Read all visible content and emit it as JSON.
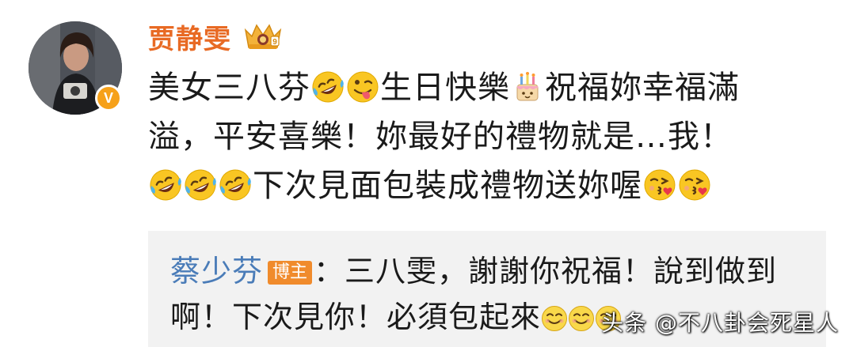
{
  "post": {
    "username": "贾静雯",
    "verified_badge": "V",
    "content": {
      "line1": {
        "t1": "美女三八芬",
        "t2": "生日快樂",
        "t3": "祝福妳幸福滿"
      },
      "line2": "溢，平安喜樂！妳最好的禮物就是…我！",
      "line3": {
        "t1": "下次見面包裝成禮物送妳喔"
      }
    },
    "icons": {
      "crown": "crown-medal-icon",
      "laugh": "rofl-emoji-icon",
      "tongue": "winking-tongue-emoji-icon",
      "cake": "birthday-cake-emoji-icon",
      "kiss": "blowing-kiss-emoji-icon",
      "smile": "smiling-face-emoji-icon"
    }
  },
  "reply": {
    "author": "蔡少芬",
    "badge": "博主",
    "line1": "：三八雯，謝謝你祝福！說到做到",
    "line2": "啊！下次見你！必須包起來"
  },
  "watermark": "头条 @不八卦会死星人",
  "colors": {
    "username": "#e86a24",
    "reply_author": "#4a7cb8",
    "host_badge": "#f08b2c",
    "verified": "#f6a11a",
    "reply_bg": "#f2f2f2"
  }
}
